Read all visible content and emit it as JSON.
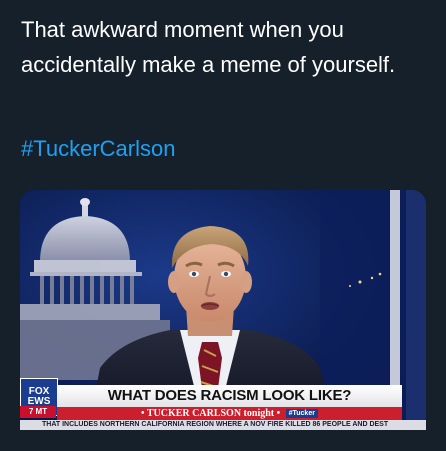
{
  "tweet": {
    "text": "That awkward moment when you accidentally make a meme of yourself.",
    "hashtag": "#TuckerCarlson"
  },
  "media": {
    "image_alt_icon": "tucker-carlson-broadcast-photo",
    "logo_line1": "FOX",
    "logo_line2": "EWS",
    "logo_badge": "7 MT",
    "headline": "WHAT DOES RACISM LOOK LIKE?",
    "subline": "• TUCKER CARLSON tonight •",
    "subline_tag": "#Tucker",
    "ticker": "THAT INCLUDES NORTHERN CALIFORNIA REGION WHERE A NOV FIRE KILLED 86 PEOPLE AND DEST"
  },
  "colors": {
    "background": "#15202b",
    "text": "#ffffff",
    "hashtag": "#1da1f2",
    "headline_bg": "#ffffff",
    "subline_bg": "#cc1f2e",
    "logo_bg": "#1a3d8f"
  }
}
